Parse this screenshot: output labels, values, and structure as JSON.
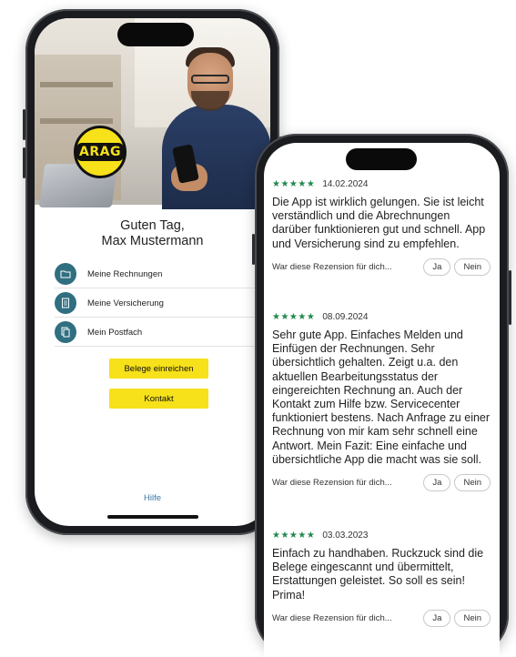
{
  "app1": {
    "greeting_line1": "Guten Tag,",
    "greeting_line2": "Max Mustermann",
    "logo_text": "ARAG",
    "menu": [
      {
        "label": "Meine Rechnungen",
        "icon": "folder-icon"
      },
      {
        "label": "Meine Versicherung",
        "icon": "document-icon"
      },
      {
        "label": "Mein Postfach",
        "icon": "mail-document-icon"
      }
    ],
    "buttons": {
      "upload_receipts": "Belege einreichen",
      "contact": "Kontakt"
    },
    "help_link": "Hilfe",
    "colors": {
      "accent_yellow": "#f7e11a",
      "icon_teal": "#2f6f80",
      "link_blue": "#3a78a8"
    }
  },
  "app2": {
    "reviews": [
      {
        "stars": "★★★★★",
        "date": "14.02.2024",
        "text": "Die App ist wirklich gelungen. Sie ist leicht verständlich und die Abrech­nungen darüber funktionieren gut und schnell. App und Versicherung sind zu empfehlen.",
        "question": "War diese Rezension für dich...",
        "yes": "Ja",
        "no": "Nein"
      },
      {
        "stars": "★★★★★",
        "date": "08.09.2024",
        "text": "Sehr gute App. Einfaches Melden und Einfügen der Rechnungen. Sehr übersichtlich gehalten. Zeigt u.a. den aktuellen Bearbeitungsstatus der eingereichten Rechnung an. Auch der Kontakt zum Hilfe bzw. Servicecenter funktioniert bestens. Nach Anfrage zu einer Rechnung von mir kam sehr schnell eine Antwort. Mein Fazit: Eine einfache und übersichtliche App die macht was sie soll.",
        "question": "War diese Rezension für dich...",
        "yes": "Ja",
        "no": "Nein"
      },
      {
        "stars": "★★★★★",
        "date": "03.03.2023",
        "text": "Einfach zu handhaben. Ruckzuck sind die Belege eingescannt und übermittelt, Erstattungen geleistet. So soll es sein! Prima!",
        "question": "War diese Rezension für dich...",
        "yes": "Ja",
        "no": "Nein"
      }
    ],
    "colors": {
      "star_green": "#1f8a4c"
    }
  }
}
